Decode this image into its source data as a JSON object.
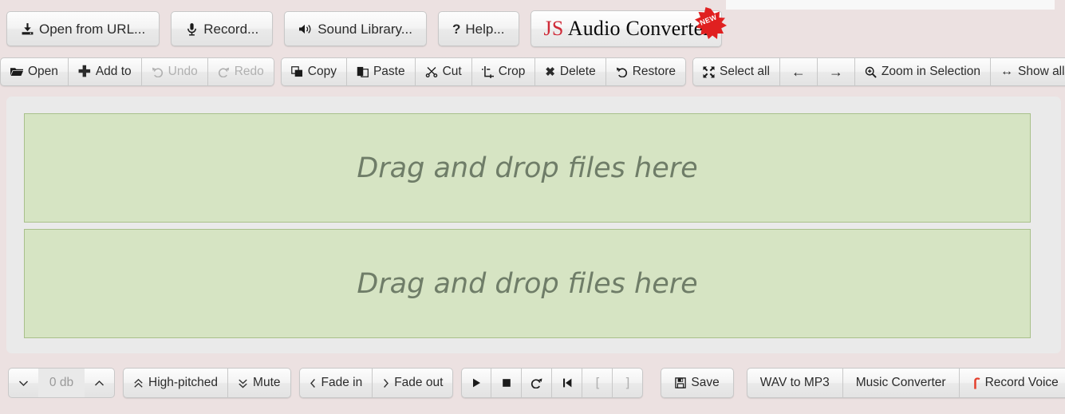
{
  "app": {
    "logo_main": "Audio Converter",
    "logo_prefix": "JS",
    "logo_badge": "NEW"
  },
  "topbar": {
    "buttons": [
      {
        "label": "Open from URL...",
        "icon": "download-icon"
      },
      {
        "label": "Record...",
        "icon": "microphone-icon"
      },
      {
        "label": "Sound Library...",
        "icon": "speaker-icon"
      },
      {
        "label": "Help...",
        "icon": "question-mark-icon"
      }
    ]
  },
  "edit_toolbar": {
    "group1": [
      {
        "label": "Open",
        "icon": "folder-open-icon",
        "disabled": false
      },
      {
        "label": "Add to",
        "icon": "plus-icon",
        "disabled": false
      },
      {
        "label": "Undo",
        "icon": "undo-icon",
        "disabled": true
      },
      {
        "label": "Redo",
        "icon": "redo-icon",
        "disabled": true
      }
    ],
    "group2": [
      {
        "label": "Copy",
        "icon": "copy-icon",
        "disabled": false
      },
      {
        "label": "Paste",
        "icon": "paste-icon",
        "disabled": false
      },
      {
        "label": "Cut",
        "icon": "scissors-icon",
        "disabled": false
      },
      {
        "label": "Crop",
        "icon": "crop-icon",
        "disabled": false
      },
      {
        "label": "Delete",
        "icon": "cross-icon",
        "disabled": false
      },
      {
        "label": "Restore",
        "icon": "restore-icon",
        "disabled": false
      }
    ],
    "group3": [
      {
        "label": "Select all",
        "icon": "select-all-icon",
        "disabled": false
      },
      {
        "label": "",
        "icon": "arrow-left-icon",
        "disabled": false
      },
      {
        "label": "",
        "icon": "arrow-right-icon",
        "disabled": false
      },
      {
        "label": "Zoom in Selection",
        "icon": "magnifier-plus-icon",
        "disabled": false
      },
      {
        "label": "Show all",
        "icon": "arrows-horizontal-icon",
        "disabled": false
      }
    ]
  },
  "workspace": {
    "dropzone_1_text": "Drag and drop files here",
    "dropzone_2_text": "Drag and drop files here",
    "dropzone_bg": "#d6e4c3",
    "dropzone_border": "#a9c08b",
    "panel_bg": "#eaeaea"
  },
  "bottombar": {
    "gain": {
      "decrease_icon": "chevron-down-icon",
      "value": "0 db",
      "increase_icon": "chevron-up-icon"
    },
    "effects": [
      {
        "label": "High-pitched",
        "icon": "double-chevron-up-icon"
      },
      {
        "label": "Mute",
        "icon": "double-chevron-down-icon"
      }
    ],
    "fades": [
      {
        "label": "Fade in",
        "icon": "chevron-left-icon"
      },
      {
        "label": "Fade out",
        "icon": "chevron-right-icon"
      }
    ],
    "transport": [
      {
        "label": "",
        "icon": "play-icon",
        "disabled": false
      },
      {
        "label": "",
        "icon": "stop-icon",
        "disabled": false
      },
      {
        "label": "",
        "icon": "loop-icon",
        "disabled": false
      },
      {
        "label": "",
        "icon": "skip-to-start-icon",
        "disabled": false
      },
      {
        "label": "[",
        "icon": "bracket-open-icon",
        "disabled": true
      },
      {
        "label": "]",
        "icon": "bracket-close-icon",
        "disabled": true
      }
    ],
    "save": {
      "label": "Save",
      "icon": "floppy-disk-icon"
    },
    "links": [
      {
        "label": "WAV to MP3",
        "icon": ""
      },
      {
        "label": "Music Converter",
        "icon": ""
      },
      {
        "label": "Record Voice",
        "icon": "record-voice-icon"
      }
    ]
  },
  "theme": {
    "page_bg": "#ece1e1",
    "accent_red": "#cf2a37",
    "record_red": "#e4412e"
  }
}
